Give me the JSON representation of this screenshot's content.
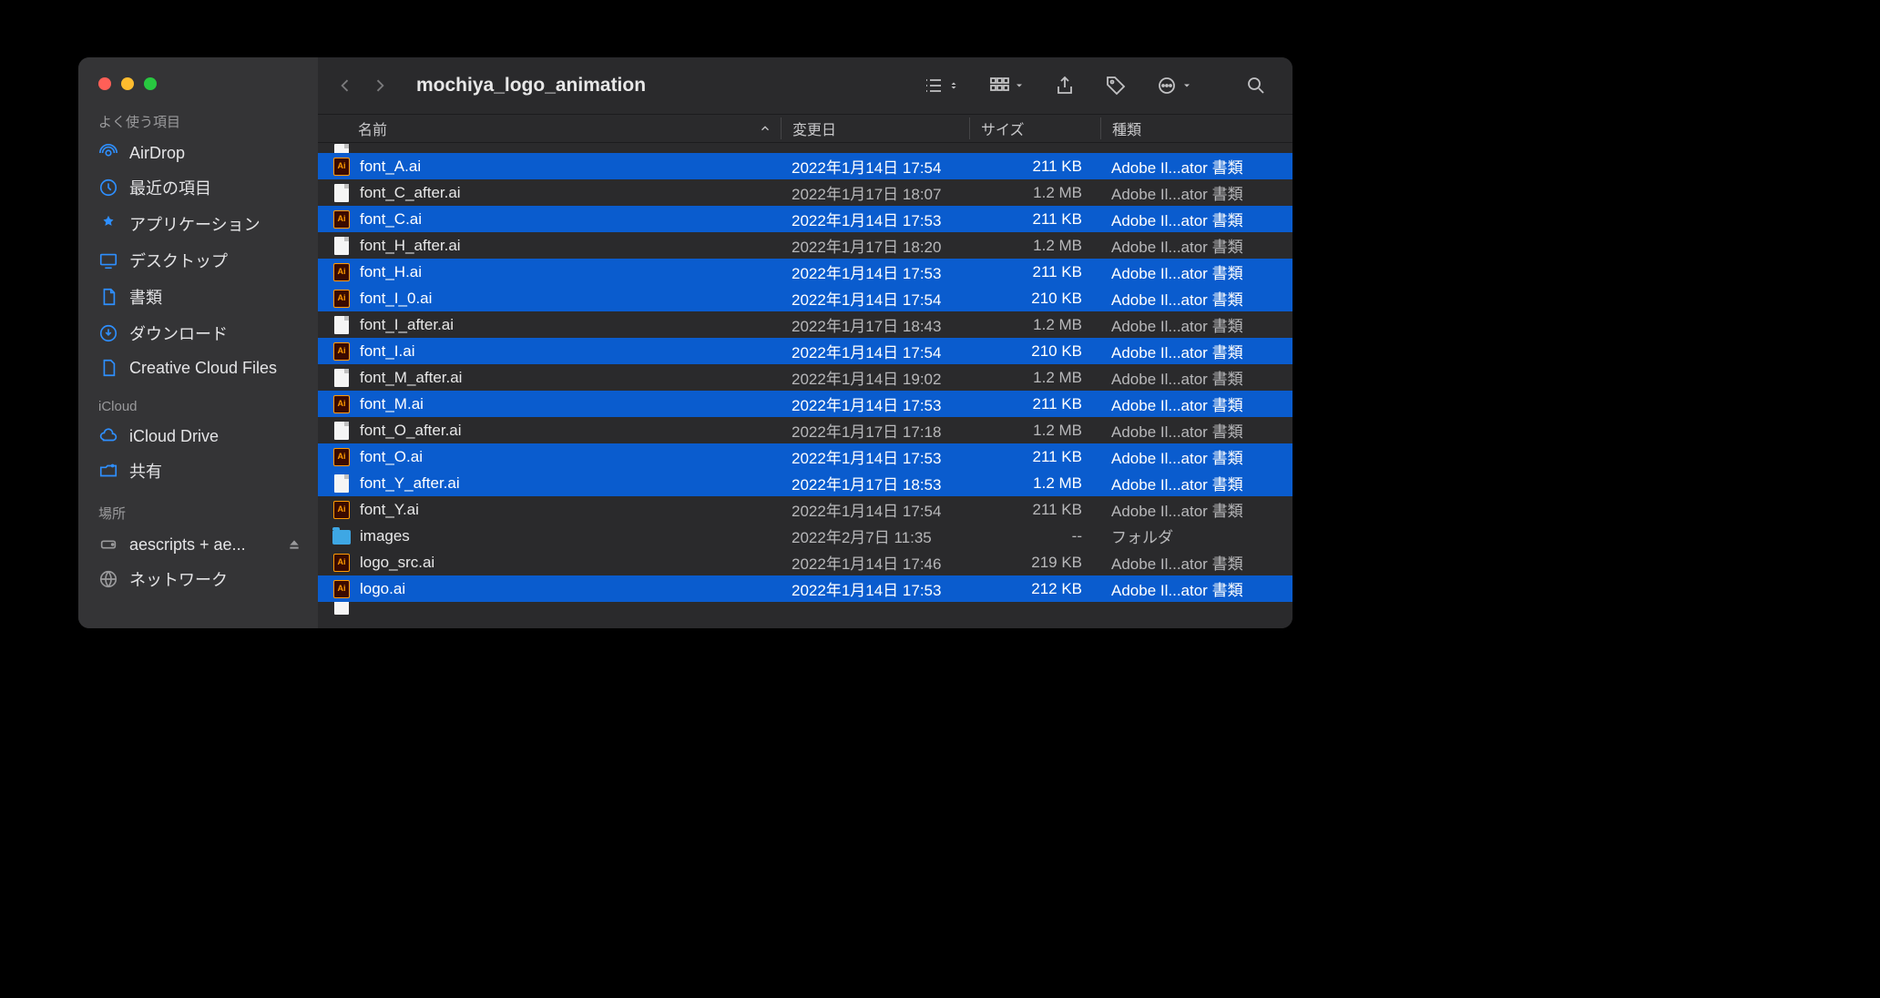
{
  "window": {
    "title": "mochiya_logo_animation"
  },
  "sidebar": {
    "sections": [
      {
        "label": "よく使う項目",
        "items": [
          {
            "icon": "airdrop",
            "label": "AirDrop"
          },
          {
            "icon": "clock",
            "label": "最近の項目"
          },
          {
            "icon": "apps",
            "label": "アプリケーション"
          },
          {
            "icon": "desktop",
            "label": "デスクトップ"
          },
          {
            "icon": "doc",
            "label": "書類"
          },
          {
            "icon": "download",
            "label": "ダウンロード"
          },
          {
            "icon": "ccfile",
            "label": "Creative Cloud Files"
          }
        ]
      },
      {
        "label": "iCloud",
        "items": [
          {
            "icon": "cloud",
            "label": "iCloud Drive"
          },
          {
            "icon": "sharedfolder",
            "label": "共有"
          }
        ]
      },
      {
        "label": "場所",
        "items": [
          {
            "icon": "disk",
            "label": "aescripts + ae...",
            "eject": true
          },
          {
            "icon": "globe",
            "label": "ネットワーク"
          }
        ]
      }
    ]
  },
  "columns": {
    "name": "名前",
    "date": "変更日",
    "size": "サイズ",
    "kind": "種類"
  },
  "files": [
    {
      "name": "font_A.ai",
      "date": "2022年1月14日 17:54",
      "size": "211 KB",
      "kind": "Adobe Il...ator 書類",
      "icon": "ai",
      "selected": true
    },
    {
      "name": "font_C_after.ai",
      "date": "2022年1月17日 18:07",
      "size": "1.2 MB",
      "kind": "Adobe Il...ator 書類",
      "icon": "doc",
      "selected": false
    },
    {
      "name": "font_C.ai",
      "date": "2022年1月14日 17:53",
      "size": "211 KB",
      "kind": "Adobe Il...ator 書類",
      "icon": "ai",
      "selected": true
    },
    {
      "name": "font_H_after.ai",
      "date": "2022年1月17日 18:20",
      "size": "1.2 MB",
      "kind": "Adobe Il...ator 書類",
      "icon": "doc",
      "selected": false
    },
    {
      "name": "font_H.ai",
      "date": "2022年1月14日 17:53",
      "size": "211 KB",
      "kind": "Adobe Il...ator 書類",
      "icon": "ai",
      "selected": true
    },
    {
      "name": "font_I_0.ai",
      "date": "2022年1月14日 17:54",
      "size": "210 KB",
      "kind": "Adobe Il...ator 書類",
      "icon": "ai",
      "selected": true
    },
    {
      "name": "font_I_after.ai",
      "date": "2022年1月17日 18:43",
      "size": "1.2 MB",
      "kind": "Adobe Il...ator 書類",
      "icon": "doc",
      "selected": false
    },
    {
      "name": "font_I.ai",
      "date": "2022年1月14日 17:54",
      "size": "210 KB",
      "kind": "Adobe Il...ator 書類",
      "icon": "ai",
      "selected": true
    },
    {
      "name": "font_M_after.ai",
      "date": "2022年1月14日 19:02",
      "size": "1.2 MB",
      "kind": "Adobe Il...ator 書類",
      "icon": "doc",
      "selected": false
    },
    {
      "name": "font_M.ai",
      "date": "2022年1月14日 17:53",
      "size": "211 KB",
      "kind": "Adobe Il...ator 書類",
      "icon": "ai",
      "selected": true
    },
    {
      "name": "font_O_after.ai",
      "date": "2022年1月17日 17:18",
      "size": "1.2 MB",
      "kind": "Adobe Il...ator 書類",
      "icon": "doc",
      "selected": false
    },
    {
      "name": "font_O.ai",
      "date": "2022年1月14日 17:53",
      "size": "211 KB",
      "kind": "Adobe Il...ator 書類",
      "icon": "ai",
      "selected": true
    },
    {
      "name": "font_Y_after.ai",
      "date": "2022年1月17日 18:53",
      "size": "1.2 MB",
      "kind": "Adobe Il...ator 書類",
      "icon": "doc",
      "selected": true
    },
    {
      "name": "font_Y.ai",
      "date": "2022年1月14日 17:54",
      "size": "211 KB",
      "kind": "Adobe Il...ator 書類",
      "icon": "ai",
      "selected": false
    },
    {
      "name": "images",
      "date": "2022年2月7日 11:35",
      "size": "--",
      "kind": "フォルダ",
      "icon": "folder",
      "selected": false
    },
    {
      "name": "logo_src.ai",
      "date": "2022年1月14日 17:46",
      "size": "219 KB",
      "kind": "Adobe Il...ator 書類",
      "icon": "ai",
      "selected": false
    },
    {
      "name": "logo.ai",
      "date": "2022年1月14日 17:53",
      "size": "212 KB",
      "kind": "Adobe Il...ator 書類",
      "icon": "ai",
      "selected": true
    }
  ]
}
